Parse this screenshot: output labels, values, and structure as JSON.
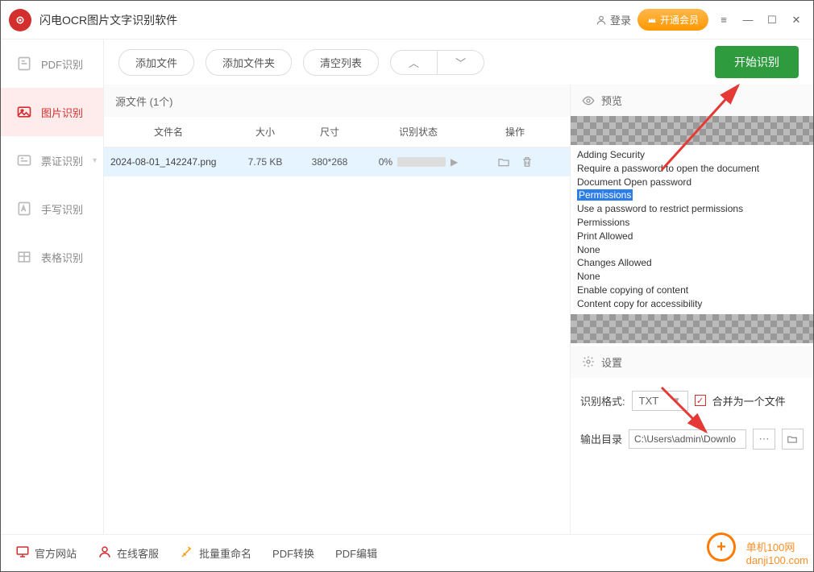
{
  "app": {
    "title": "闪电OCR图片文字识别软件",
    "login": "登录",
    "vip": "开通会员"
  },
  "sidebar": {
    "items": [
      {
        "label": "PDF识别"
      },
      {
        "label": "图片识别"
      },
      {
        "label": "票证识别"
      },
      {
        "label": "手写识别"
      },
      {
        "label": "表格识别"
      }
    ]
  },
  "toolbar": {
    "add_file": "添加文件",
    "add_folder": "添加文件夹",
    "clear": "清空列表",
    "start": "开始识别"
  },
  "source": {
    "header": "源文件 (1个)",
    "columns": {
      "name": "文件名",
      "size": "大小",
      "dim": "尺寸",
      "status": "识别状态",
      "op": "操作"
    },
    "rows": [
      {
        "name": "2024-08-01_142247.png",
        "size": "7.75 KB",
        "dim": "380*268",
        "progress": "0%"
      }
    ]
  },
  "preview": {
    "title": "预览",
    "lines": [
      "Adding Security",
      "Require a password to open the document",
      "Document Open password",
      "Permissions",
      "Use a password to restrict permissions",
      "Permissions",
      "Print Allowed",
      "None",
      "Changes Allowed",
      "None",
      "Enable copying of content",
      "Content copy for accessibility"
    ],
    "highlight_index": 3
  },
  "settings": {
    "title": "设置",
    "format_label": "识别格式:",
    "format_value": "TXT",
    "merge_label": "合并为一个文件",
    "outdir_label": "输出目录",
    "outdir_value": "C:\\Users\\admin\\Downlo"
  },
  "footer": {
    "site": "官方网站",
    "support": "在线客服",
    "rename": "批量重命名",
    "pdf_convert": "PDF转换",
    "pdf_edit": "PDF编辑"
  },
  "watermark": "单机100网\ndanji100.com"
}
